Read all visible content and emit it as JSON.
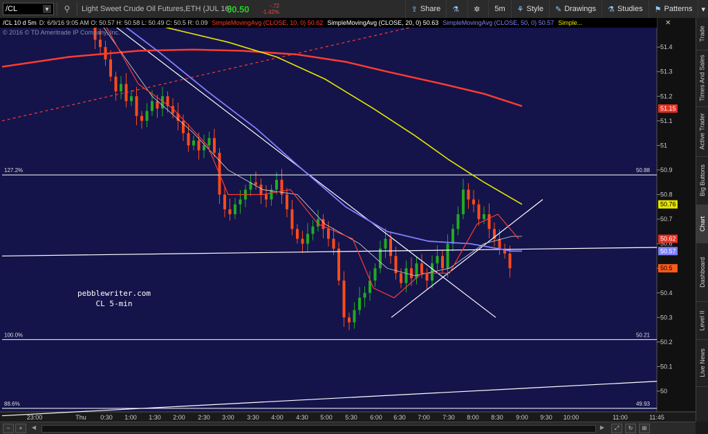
{
  "toolbar": {
    "symbol": "/CL",
    "description": "Light Sweet Crude Oil Futures,ETH (JUL 16)",
    "last_price": "50.50",
    "change": "-.72",
    "change_pct": "-1.42%",
    "buttons": [
      {
        "label": "Share",
        "icon": "share-icon"
      },
      {
        "label": "",
        "icon": "flask-icon"
      },
      {
        "label": "",
        "icon": "gear-icon"
      },
      {
        "label": "5m",
        "icon": ""
      },
      {
        "label": "Style",
        "icon": "style-icon"
      },
      {
        "label": "Drawings",
        "icon": "pencil-icon"
      },
      {
        "label": "Studies",
        "icon": "studies-icon"
      },
      {
        "label": "Patterns",
        "icon": "patterns-icon"
      }
    ]
  },
  "chart": {
    "header_symbol": "/CL 10 d 5m",
    "header_info": "D: 6/9/16 9:05 AM   O: 50.57   H: 50.58   L: 50.49   C: 50.5   R: 0.09",
    "copyright": "© 2016 © TD Ameritrade IP Company, Inc.",
    "studies": [
      {
        "label": "SimpleMovingAvg (CLOSE, 10, 0)",
        "value": "50.62",
        "color": "#ff3b30"
      },
      {
        "label": "SimpleMovingAvg (CLOSE, 20, 0)",
        "value": "50.63",
        "color": "#ffffff"
      },
      {
        "label": "SimpleMovingAvg (CLOSE, 50, 0)",
        "value": "50.57",
        "color": "#8080ff"
      },
      {
        "label": "Simple...",
        "value": "",
        "color": "#e6e600"
      }
    ],
    "watermark_line1": "pebblewriter.com",
    "watermark_line2": "CL 5-min",
    "fib_levels": [
      {
        "pct": "127.2%",
        "value": "50.88",
        "price": 50.88
      },
      {
        "pct": "100.0%",
        "value": "50.21",
        "price": 50.21
      },
      {
        "pct": "88.6%",
        "value": "49.93",
        "price": 49.93
      }
    ],
    "price_badges": [
      {
        "value": "51.15",
        "price": 51.15,
        "bg": "#e83020",
        "fg": "#ffffff"
      },
      {
        "value": "50.76",
        "price": 50.76,
        "bg": "#e6e600",
        "fg": "#000000"
      },
      {
        "value": "50.62",
        "price": 50.62,
        "bg": "#e83020",
        "fg": "#ffffff"
      },
      {
        "value": "50.57",
        "price": 50.57,
        "bg": "#8080ff",
        "fg": "#ffffff"
      },
      {
        "value": "50.5",
        "price": 50.5,
        "bg": "#ff5a1a",
        "fg": "#000000"
      }
    ],
    "y_ticks": [
      "51.4",
      "51.3",
      "51.2",
      "51.1",
      "51",
      "50.9",
      "50.8",
      "50.7",
      "50.6",
      "50.5",
      "50.4",
      "50.3",
      "50.2",
      "50.1",
      "50"
    ],
    "x_ticks": [
      "23:00",
      "Thu",
      "0:30",
      "1:00",
      "1:30",
      "2:00",
      "2:30",
      "3:00",
      "3:30",
      "4:00",
      "4:30",
      "5:00",
      "5:30",
      "6:00",
      "6:30",
      "7:00",
      "7:30",
      "8:00",
      "8:30",
      "9:00",
      "9:30",
      "10:00",
      "11:00",
      "11:45"
    ],
    "colors": {
      "background": "#14144a",
      "up": "#22aa22",
      "down": "#ff4a1a"
    }
  },
  "sidebar": {
    "tabs": [
      "Trade",
      "Times And Sales",
      "Active Trader",
      "Big Buttons",
      "Chart",
      "Dashboard",
      "Level II",
      "Live News"
    ],
    "active": "Chart"
  }
}
